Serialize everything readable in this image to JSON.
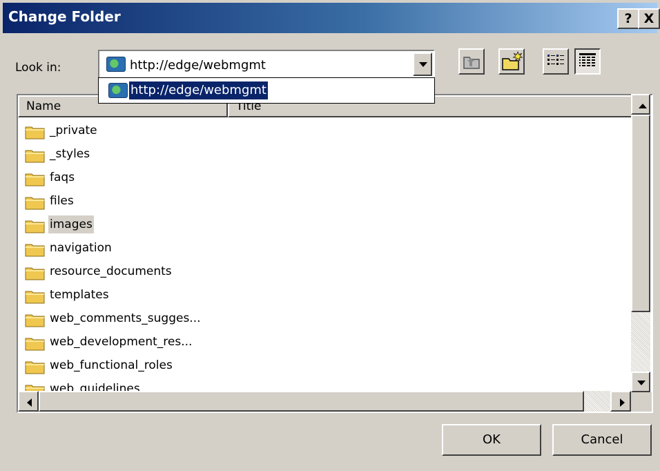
{
  "dialog": {
    "title": "Change Folder",
    "help_button": "?",
    "close_button": "X"
  },
  "look_in": {
    "label": "Look in:",
    "value": "http://edge/webmgmt",
    "dropdown_options": [
      "http://edge/webmgmt"
    ],
    "selected_option": "http://edge/webmgmt"
  },
  "toolbar": {
    "icons": [
      "up-one-level-icon",
      "new-folder-icon",
      "list-view-icon",
      "details-view-icon"
    ],
    "active_view": "details"
  },
  "file_list": {
    "columns": [
      "Name",
      "Title"
    ],
    "items": [
      "_private",
      "_styles",
      "faqs",
      "files",
      "images",
      "navigation",
      "resource_documents",
      "templates",
      "web_comments_sugges...",
      "web_development_res...",
      "web_functional_roles",
      "web_guidelines"
    ],
    "selected_item": "images"
  },
  "buttons": {
    "ok": "OK",
    "cancel": "Cancel"
  },
  "colors": {
    "dialog_background": "#d4d0c8",
    "title_gradient_start": "#0a246a",
    "title_gradient_end": "#a6caf0",
    "selection": "#0a246a",
    "folder_yellow": "#f0c850"
  }
}
